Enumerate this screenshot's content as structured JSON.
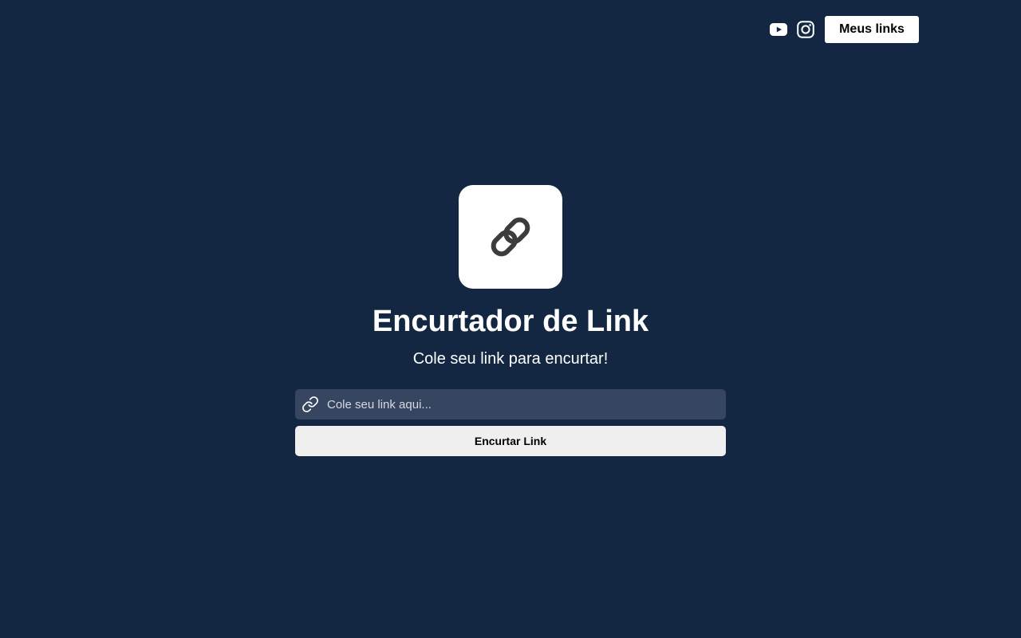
{
  "header": {
    "social": [
      {
        "name": "youtube",
        "icon": "youtube-icon"
      },
      {
        "name": "instagram",
        "icon": "instagram-icon"
      }
    ],
    "my_links_label": "Meus links"
  },
  "main": {
    "logo_icon": "link-chain-icon",
    "title": "Encurtador de Link",
    "subtitle": "Cole seu link para encurtar!",
    "input": {
      "value": "",
      "placeholder": "Cole seu link aqui...",
      "icon": "link-icon"
    },
    "submit_label": "Encurtar Link"
  },
  "colors": {
    "background": "#132743",
    "input_background": "#374660",
    "button_background": "#efefef",
    "logo_icon": "#3c3c3c"
  }
}
